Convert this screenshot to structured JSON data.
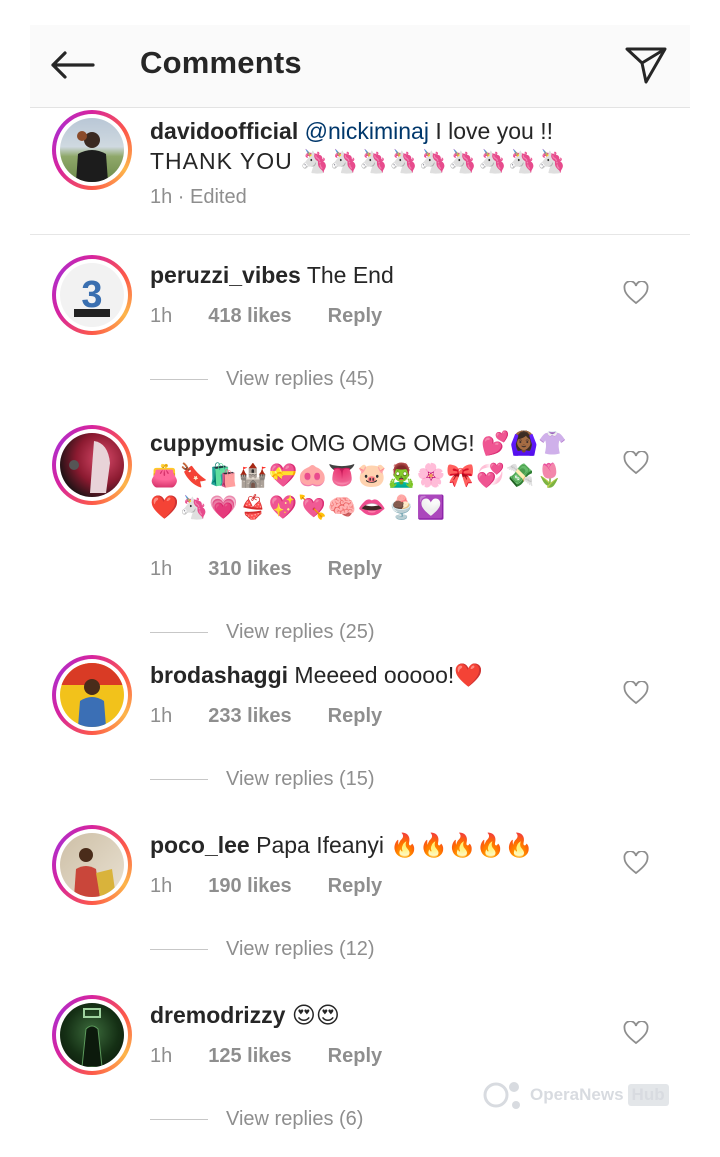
{
  "header": {
    "title": "Comments"
  },
  "caption": {
    "username": "davidoofficial",
    "mention": "@nickiminaj",
    "text_line1": " I love you !!",
    "text_line2": "THANK YOU 🦄🦄🦄🦄🦄🦄🦄🦄🦄",
    "meta": "1h · Edited"
  },
  "comments": [
    {
      "username": "peruzzi_vibes",
      "text": " The End",
      "time": "1h",
      "likes": "418 likes",
      "reply": "Reply",
      "view_replies": "View replies (45)"
    },
    {
      "username": "cuppymusic",
      "text": " OMG OMG OMG! 💕🙆🏾‍♀️👚",
      "text2": "👛🔖🛍️🏰💝🐽👅🐷🧟‍♂️🌸🎀💞💸🌷",
      "text3": "❤️🦄💗👙💖💘🧠👄🍨💟",
      "time": "1h",
      "likes": "310 likes",
      "reply": "Reply",
      "view_replies": "View replies (25)"
    },
    {
      "username": "brodashaggi",
      "text": " Meeeed ooooo!❤️",
      "time": "1h",
      "likes": "233 likes",
      "reply": "Reply",
      "view_replies": "View replies (15)"
    },
    {
      "username": "poco_lee",
      "text": " Papa Ifeanyi 🔥🔥🔥🔥🔥",
      "time": "1h",
      "likes": "190 likes",
      "reply": "Reply",
      "view_replies": "View replies (12)"
    },
    {
      "username": "dremodrizzy",
      "text": " 😍😍",
      "time": "1h",
      "likes": "125 likes",
      "reply": "Reply",
      "view_replies": "View replies (6)"
    }
  ],
  "watermark": {
    "brand": "OperaNews",
    "suffix": "Hub"
  },
  "icons": {
    "back": "arrow-left-icon",
    "send": "send-icon",
    "like": "heart-outline-icon"
  },
  "colors": {
    "mention": "#00376b",
    "meta": "#8e8e8e",
    "story_ring": "#d6249f"
  }
}
